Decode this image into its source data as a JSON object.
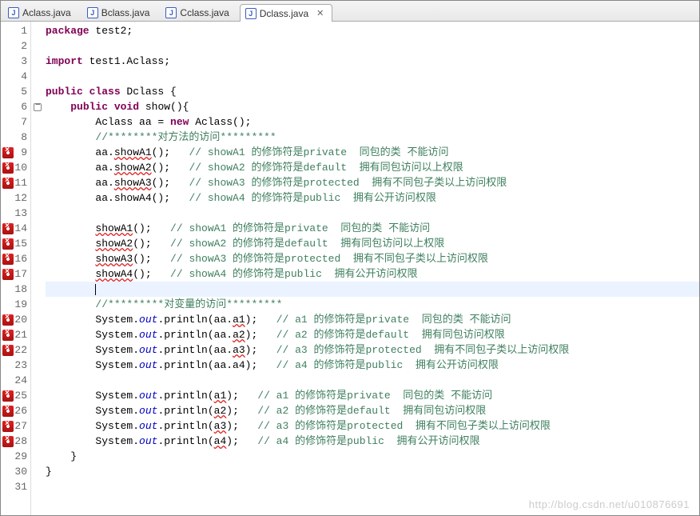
{
  "tabs": [
    {
      "label": "Aclass.java",
      "active": false
    },
    {
      "label": "Bclass.java",
      "active": false
    },
    {
      "label": "Cclass.java",
      "active": false
    },
    {
      "label": "Dclass.java",
      "active": true
    }
  ],
  "watermark": "http://blog.csdn.net/u010876691",
  "lines": [
    {
      "n": 1,
      "ann": null,
      "hl": false,
      "segs": [
        [
          "kw",
          "package"
        ],
        [
          "plain",
          " test2;"
        ]
      ]
    },
    {
      "n": 2,
      "ann": null,
      "hl": false,
      "segs": [
        [
          "plain",
          ""
        ]
      ]
    },
    {
      "n": 3,
      "ann": null,
      "hl": false,
      "segs": [
        [
          "kw",
          "import"
        ],
        [
          "plain",
          " test1.Aclass;"
        ]
      ]
    },
    {
      "n": 4,
      "ann": null,
      "hl": false,
      "segs": [
        [
          "plain",
          ""
        ]
      ]
    },
    {
      "n": 5,
      "ann": null,
      "hl": false,
      "segs": [
        [
          "kw",
          "public class"
        ],
        [
          "plain",
          " Dclass {"
        ]
      ]
    },
    {
      "n": 6,
      "ann": "fold",
      "hl": false,
      "segs": [
        [
          "plain",
          "    "
        ],
        [
          "kw",
          "public void"
        ],
        [
          "plain",
          " show(){"
        ]
      ]
    },
    {
      "n": 7,
      "ann": null,
      "hl": false,
      "segs": [
        [
          "plain",
          "        Aclass aa = "
        ],
        [
          "kw",
          "new"
        ],
        [
          "plain",
          " Aclass();"
        ]
      ]
    },
    {
      "n": 8,
      "ann": null,
      "hl": false,
      "segs": [
        [
          "plain",
          "        "
        ],
        [
          "cm",
          "//********对方法的访问*********"
        ]
      ]
    },
    {
      "n": 9,
      "ann": "err",
      "hl": false,
      "segs": [
        [
          "plain",
          "        aa."
        ],
        [
          "errul",
          "showA1"
        ],
        [
          "plain",
          "();   "
        ],
        [
          "cm",
          "// showA1 的修饰符是private  同包的类 不能访问"
        ]
      ]
    },
    {
      "n": 10,
      "ann": "err",
      "hl": false,
      "segs": [
        [
          "plain",
          "        aa."
        ],
        [
          "errul",
          "showA2"
        ],
        [
          "plain",
          "();   "
        ],
        [
          "cm",
          "// showA2 的修饰符是default  拥有同包访问以上权限"
        ]
      ]
    },
    {
      "n": 11,
      "ann": "err",
      "hl": false,
      "segs": [
        [
          "plain",
          "        aa."
        ],
        [
          "errul",
          "showA3"
        ],
        [
          "plain",
          "();   "
        ],
        [
          "cm",
          "// showA3 的修饰符是protected  拥有不同包子类以上访问权限"
        ]
      ]
    },
    {
      "n": 12,
      "ann": null,
      "hl": false,
      "segs": [
        [
          "plain",
          "        aa.showA4();   "
        ],
        [
          "cm",
          "// showA4 的修饰符是public  拥有公开访问权限"
        ]
      ]
    },
    {
      "n": 13,
      "ann": null,
      "hl": false,
      "segs": [
        [
          "plain",
          ""
        ]
      ]
    },
    {
      "n": 14,
      "ann": "err",
      "hl": false,
      "segs": [
        [
          "plain",
          "        "
        ],
        [
          "errul",
          "showA1"
        ],
        [
          "plain",
          "();   "
        ],
        [
          "cm",
          "// showA1 的修饰符是private  同包的类 不能访问"
        ]
      ]
    },
    {
      "n": 15,
      "ann": "err",
      "hl": false,
      "segs": [
        [
          "plain",
          "        "
        ],
        [
          "errul",
          "showA2"
        ],
        [
          "plain",
          "();   "
        ],
        [
          "cm",
          "// showA2 的修饰符是default  拥有同包访问以上权限"
        ]
      ]
    },
    {
      "n": 16,
      "ann": "err",
      "hl": false,
      "segs": [
        [
          "plain",
          "        "
        ],
        [
          "errul",
          "showA3"
        ],
        [
          "plain",
          "();   "
        ],
        [
          "cm",
          "// showA3 的修饰符是protected  拥有不同包子类以上访问权限"
        ]
      ]
    },
    {
      "n": 17,
      "ann": "err",
      "hl": false,
      "segs": [
        [
          "plain",
          "        "
        ],
        [
          "errul",
          "showA4"
        ],
        [
          "plain",
          "();   "
        ],
        [
          "cm",
          "// showA4 的修饰符是public  拥有公开访问权限"
        ]
      ]
    },
    {
      "n": 18,
      "ann": null,
      "hl": true,
      "segs": [
        [
          "plain",
          "        "
        ],
        [
          "caret",
          ""
        ]
      ]
    },
    {
      "n": 19,
      "ann": null,
      "hl": false,
      "segs": [
        [
          "plain",
          "        "
        ],
        [
          "cm",
          "//*********对变量的访问*********"
        ]
      ]
    },
    {
      "n": 20,
      "ann": "err",
      "hl": false,
      "segs": [
        [
          "plain",
          "        System."
        ],
        [
          "it",
          "out"
        ],
        [
          "plain",
          ".println(aa."
        ],
        [
          "errul",
          "a1"
        ],
        [
          "plain",
          ");   "
        ],
        [
          "cm",
          "// a1 的修饰符是private  同包的类 不能访问"
        ]
      ]
    },
    {
      "n": 21,
      "ann": "err",
      "hl": false,
      "segs": [
        [
          "plain",
          "        System."
        ],
        [
          "it",
          "out"
        ],
        [
          "plain",
          ".println(aa."
        ],
        [
          "errul",
          "a2"
        ],
        [
          "plain",
          ");   "
        ],
        [
          "cm",
          "// a2 的修饰符是default  拥有同包访问权限"
        ]
      ]
    },
    {
      "n": 22,
      "ann": "err",
      "hl": false,
      "segs": [
        [
          "plain",
          "        System."
        ],
        [
          "it",
          "out"
        ],
        [
          "plain",
          ".println(aa."
        ],
        [
          "errul",
          "a3"
        ],
        [
          "plain",
          ");   "
        ],
        [
          "cm",
          "// a3 的修饰符是protected  拥有不同包子类以上访问权限"
        ]
      ]
    },
    {
      "n": 23,
      "ann": null,
      "hl": false,
      "segs": [
        [
          "plain",
          "        System."
        ],
        [
          "it",
          "out"
        ],
        [
          "plain",
          ".println(aa.a4);   "
        ],
        [
          "cm",
          "// a4 的修饰符是public  拥有公开访问权限"
        ]
      ]
    },
    {
      "n": 24,
      "ann": null,
      "hl": false,
      "segs": [
        [
          "plain",
          ""
        ]
      ]
    },
    {
      "n": 25,
      "ann": "err",
      "hl": false,
      "segs": [
        [
          "plain",
          "        System."
        ],
        [
          "it",
          "out"
        ],
        [
          "plain",
          ".println("
        ],
        [
          "errul",
          "a1"
        ],
        [
          "plain",
          ");   "
        ],
        [
          "cm",
          "// a1 的修饰符是private  同包的类 不能访问"
        ]
      ]
    },
    {
      "n": 26,
      "ann": "err",
      "hl": false,
      "segs": [
        [
          "plain",
          "        System."
        ],
        [
          "it",
          "out"
        ],
        [
          "plain",
          ".println("
        ],
        [
          "errul",
          "a2"
        ],
        [
          "plain",
          ");   "
        ],
        [
          "cm",
          "// a2 的修饰符是default  拥有同包访问权限"
        ]
      ]
    },
    {
      "n": 27,
      "ann": "err",
      "hl": false,
      "segs": [
        [
          "plain",
          "        System."
        ],
        [
          "it",
          "out"
        ],
        [
          "plain",
          ".println("
        ],
        [
          "errul",
          "a3"
        ],
        [
          "plain",
          ");   "
        ],
        [
          "cm",
          "// a3 的修饰符是protected  拥有不同包子类以上访问权限"
        ]
      ]
    },
    {
      "n": 28,
      "ann": "err",
      "hl": false,
      "segs": [
        [
          "plain",
          "        System."
        ],
        [
          "it",
          "out"
        ],
        [
          "plain",
          ".println("
        ],
        [
          "errul",
          "a4"
        ],
        [
          "plain",
          ");   "
        ],
        [
          "cm",
          "// a4 的修饰符是public  拥有公开访问权限"
        ]
      ]
    },
    {
      "n": 29,
      "ann": null,
      "hl": false,
      "segs": [
        [
          "plain",
          "    }"
        ]
      ]
    },
    {
      "n": 30,
      "ann": null,
      "hl": false,
      "segs": [
        [
          "plain",
          "}"
        ]
      ]
    },
    {
      "n": 31,
      "ann": null,
      "hl": false,
      "segs": [
        [
          "plain",
          ""
        ]
      ]
    }
  ]
}
